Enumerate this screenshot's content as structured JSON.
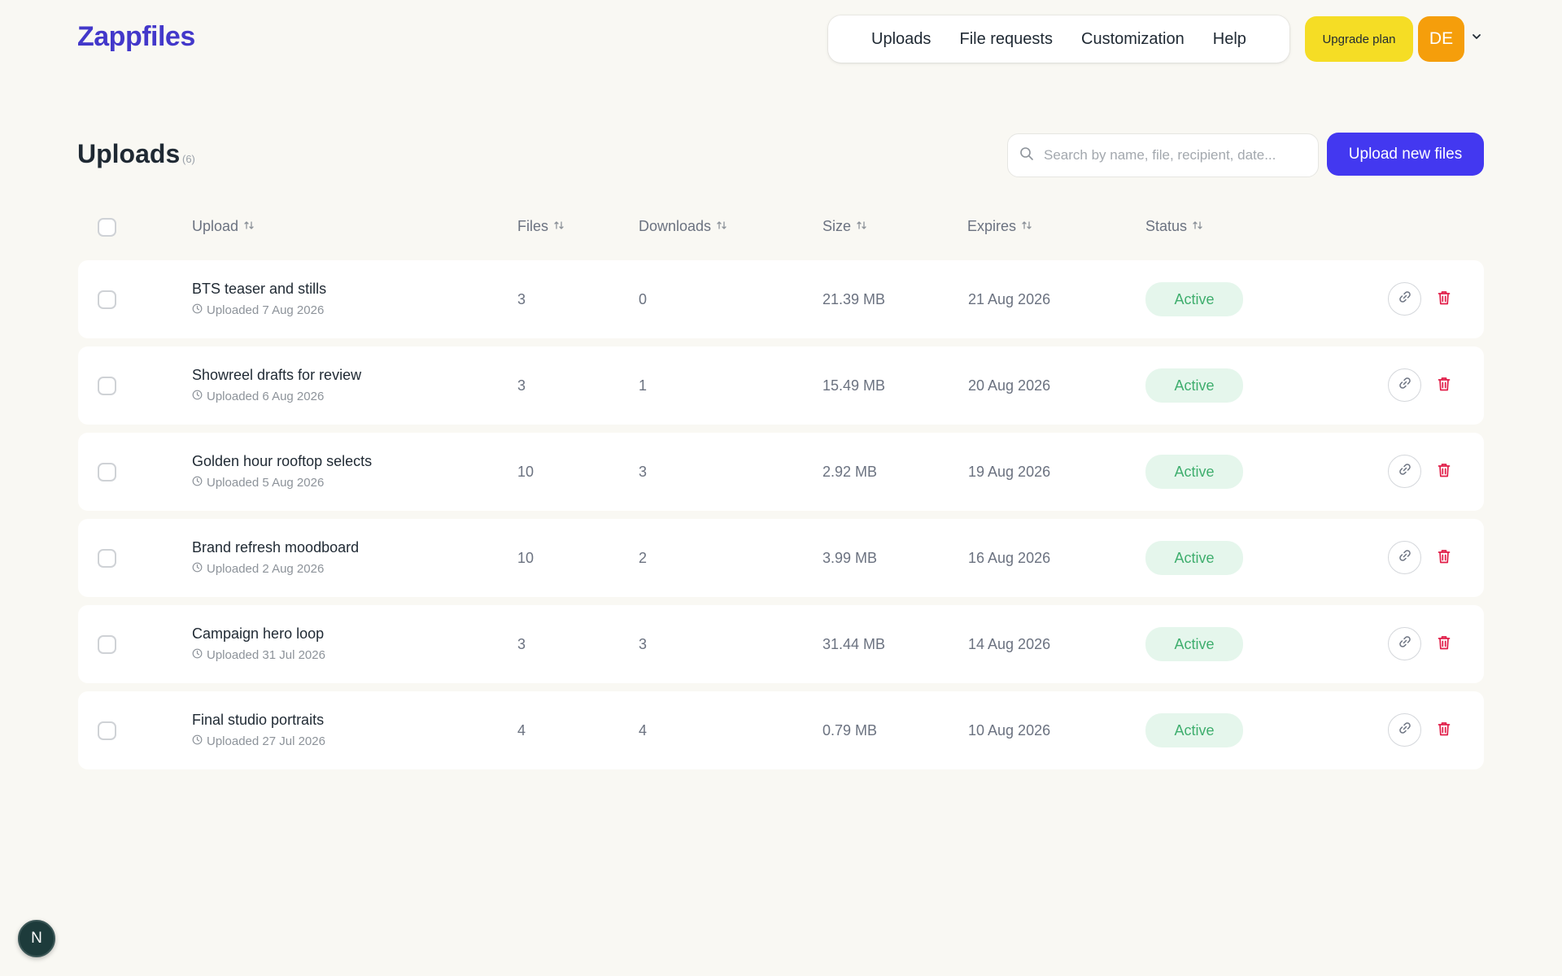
{
  "brand": {
    "name": "Zappfiles",
    "accent": "#4338ca"
  },
  "nav": {
    "items": [
      "Uploads",
      "File requests",
      "Customization",
      "Help"
    ],
    "upgrade_label": "Upgrade plan",
    "avatar_initials": "DE"
  },
  "page": {
    "title": "Uploads",
    "count": "(6)",
    "search_placeholder": "Search by name, file, recipient, date...",
    "upload_button": "Upload new files"
  },
  "table": {
    "columns": [
      "Upload",
      "Files",
      "Downloads",
      "Size",
      "Expires",
      "Status"
    ],
    "rows": [
      {
        "name": "BTS teaser and stills",
        "uploaded": "Uploaded 7 Aug 2026",
        "files": "3",
        "downloads": "0",
        "size": "21.39 MB",
        "expires": "21 Aug 2026",
        "status": "Active"
      },
      {
        "name": "Showreel drafts for review",
        "uploaded": "Uploaded 6 Aug 2026",
        "files": "3",
        "downloads": "1",
        "size": "15.49 MB",
        "expires": "20 Aug 2026",
        "status": "Active"
      },
      {
        "name": "Golden hour rooftop selects",
        "uploaded": "Uploaded 5 Aug 2026",
        "files": "10",
        "downloads": "3",
        "size": "2.92 MB",
        "expires": "19 Aug 2026",
        "status": "Active"
      },
      {
        "name": "Brand refresh moodboard",
        "uploaded": "Uploaded 2 Aug 2026",
        "files": "10",
        "downloads": "2",
        "size": "3.99 MB",
        "expires": "16 Aug 2026",
        "status": "Active"
      },
      {
        "name": "Campaign hero loop",
        "uploaded": "Uploaded 31 Jul 2026",
        "files": "3",
        "downloads": "3",
        "size": "31.44 MB",
        "expires": "14 Aug 2026",
        "status": "Active"
      },
      {
        "name": "Final studio portraits",
        "uploaded": "Uploaded 27 Jul 2026",
        "files": "4",
        "downloads": "4",
        "size": "0.79 MB",
        "expires": "10 Aug 2026",
        "status": "Active"
      }
    ]
  },
  "dev_badge": "N",
  "colors": {
    "primary_button": "#4338f0",
    "upgrade": "#f5dd25",
    "avatar": "#f59e0b",
    "status_active_bg": "#e5f6ec",
    "status_active_text": "#3fae6e",
    "delete": "#e11d48"
  }
}
